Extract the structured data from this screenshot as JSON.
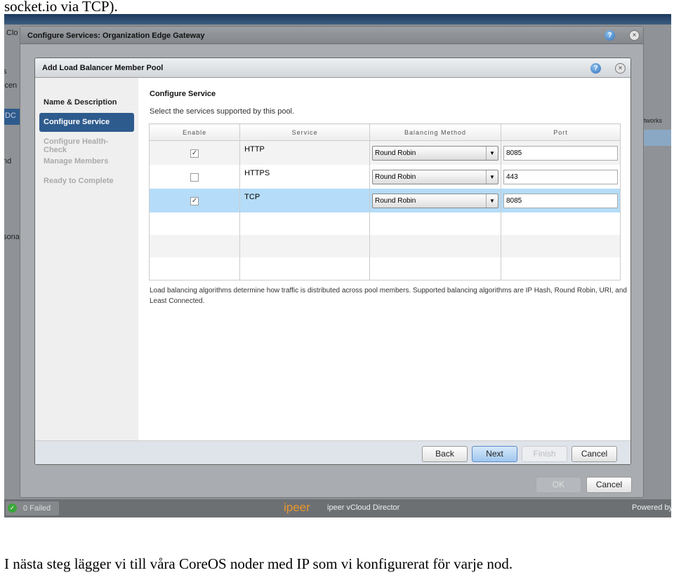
{
  "article": {
    "top_text": "socket.io via TCP).",
    "bottom_text": "I nästa steg lägger vi till våra CoreOS noder med IP som vi konfigurerat för varje nod."
  },
  "background": {
    "fragments": [
      "Clo",
      "s",
      "icen",
      "DC",
      "nd",
      "sona",
      "tworks"
    ]
  },
  "outer_dialog": {
    "title": "Configure Services: Organization Edge Gateway",
    "ok": "OK",
    "cancel": "Cancel"
  },
  "inner_dialog": {
    "title": "Add Load Balancer Member Pool",
    "nav": [
      {
        "label": "Name & Description",
        "state": "done"
      },
      {
        "label": "Configure Service",
        "state": "active"
      },
      {
        "label": "Configure Health-Check",
        "state": "pending"
      },
      {
        "label": "Manage Members",
        "state": "pending"
      },
      {
        "label": "Ready to Complete",
        "state": "pending"
      }
    ],
    "heading": "Configure Service",
    "subtitle": "Select the services supported by this pool.",
    "columns": [
      "Enable",
      "Service",
      "Balancing Method",
      "Port"
    ],
    "rows": [
      {
        "enabled": true,
        "service": "HTTP",
        "method": "Round Robin",
        "port": "8085"
      },
      {
        "enabled": false,
        "service": "HTTPS",
        "method": "Round Robin",
        "port": "443"
      },
      {
        "enabled": true,
        "service": "TCP",
        "method": "Round Robin",
        "port": "8085",
        "selected": true
      }
    ],
    "note": "Load balancing algorithms determine how traffic is distributed across pool members. Supported balancing algorithms are IP Hash, Round Robin, URI, and Least Connected.",
    "buttons": {
      "back": "Back",
      "next": "Next",
      "finish": "Finish",
      "cancel": "Cancel"
    }
  },
  "status_bar": {
    "failed": "0 Failed",
    "brand": "ipeer",
    "product": "ipeer vCloud Director",
    "powered": "Powered by"
  },
  "colors": {
    "accent": "#2e5b8d",
    "selected_row": "#b5dcf8",
    "brand": "#e8952c"
  }
}
